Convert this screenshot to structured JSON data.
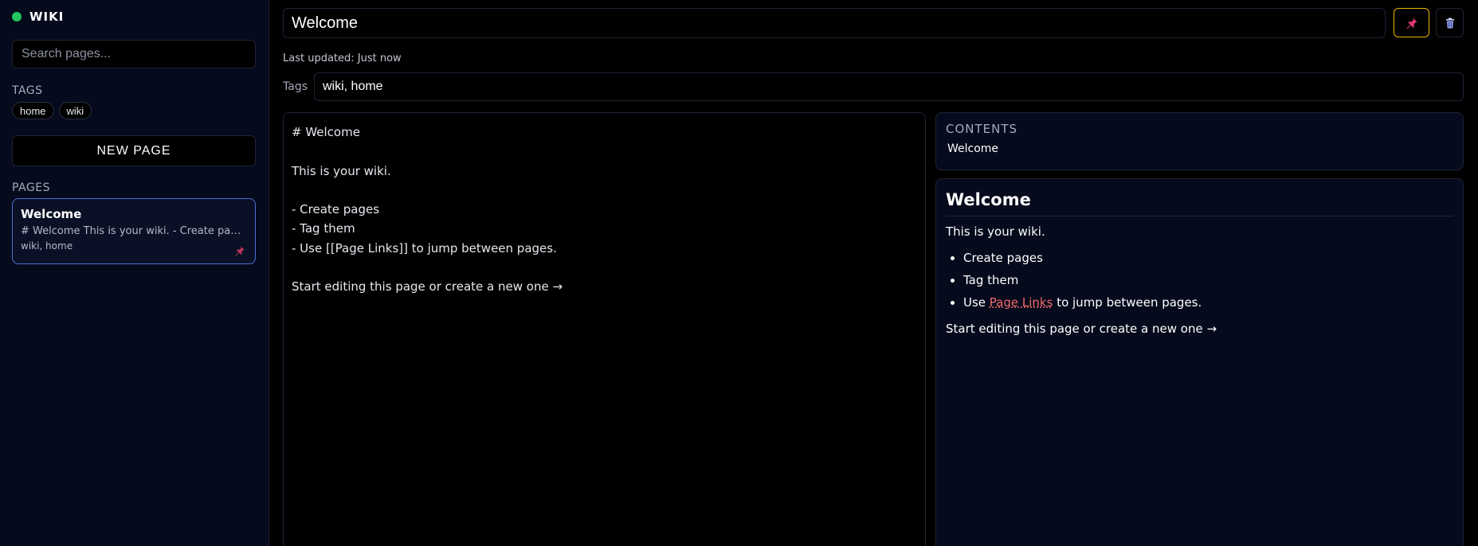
{
  "app": {
    "title": "WIKI",
    "status_color": "#22c55e"
  },
  "sidebar": {
    "search_placeholder": "Search pages...",
    "tags_label": "TAGS",
    "tags": [
      "home",
      "wiki"
    ],
    "new_page_label": "NEW PAGE",
    "pages_label": "PAGES",
    "pages": [
      {
        "title": "Welcome",
        "excerpt": "# Welcome This is your wiki. - Create pages - Tag them - Use [[Page Links]] to jump between pages.",
        "tags": "wiki, home",
        "pinned": true
      }
    ]
  },
  "editor": {
    "title_value": "Welcome",
    "last_updated": "Last updated: Just now",
    "tags_label": "Tags",
    "tags_value": "wiki, home",
    "content": "# Welcome\n\nThis is your wiki.\n\n- Create pages\n- Tag them\n- Use [[Page Links]] to jump between pages.\n\nStart editing this page or create a new one →"
  },
  "toc": {
    "label": "CONTENTS",
    "items": [
      "Welcome"
    ]
  },
  "preview": {
    "heading": "Welcome",
    "intro": "This is your wiki.",
    "list": [
      "Create pages",
      "Tag them"
    ],
    "link_item": {
      "prefix": "Use ",
      "link_text": "Page Links",
      "suffix": " to jump between pages."
    },
    "outro": "Start editing this page or create a new one →"
  },
  "colors": {
    "accent_pin": "#e0386b",
    "pin_border": "#eab308",
    "card_border": "#4d6fd6",
    "link": "#f06b6b"
  },
  "icons": {
    "pin": "pin-icon",
    "delete": "trash-icon"
  }
}
